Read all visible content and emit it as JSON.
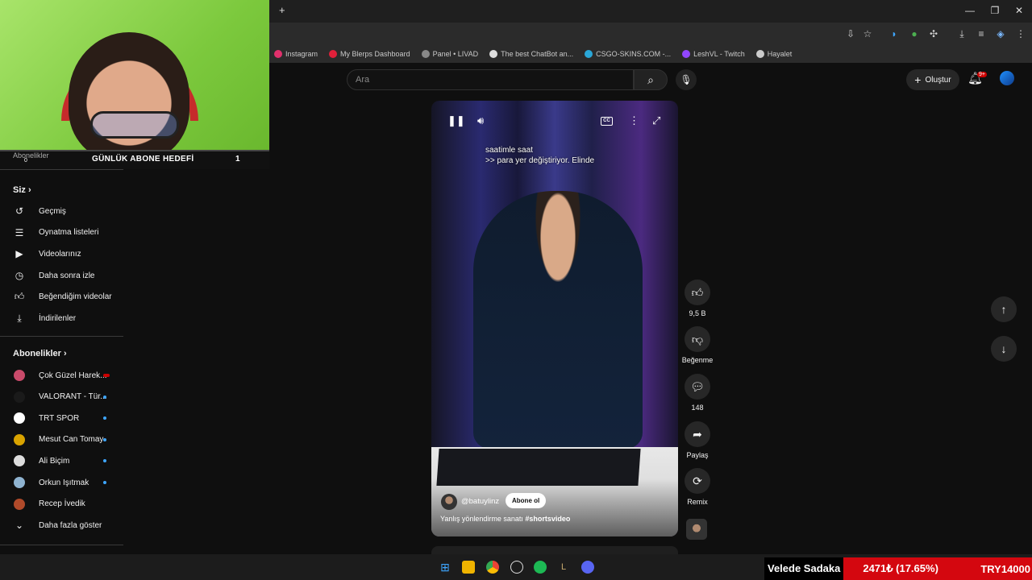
{
  "browser": {
    "new_tab": "+",
    "window_controls": {
      "minimize": "—",
      "maximize": "❐",
      "close": "✕"
    },
    "bookmarks": [
      {
        "label": "Instagram",
        "color": "#e1306c"
      },
      {
        "label": "My Blerps Dashboard",
        "color": "#e0203a"
      },
      {
        "label": "Panel • LIVAD",
        "color": "#888888"
      },
      {
        "label": "The best ChatBot an...",
        "color": "#dddddd"
      },
      {
        "label": "CSGO-SKINS.COM -...",
        "color": "#2aa7d8"
      },
      {
        "label": "LeshVL - Twitch",
        "color": "#9146ff"
      },
      {
        "label": "Hayalet",
        "color": "#cccccc"
      }
    ]
  },
  "overlay": {
    "sub_goal_label": "GÜNLÜK ABONE HEDEFİ",
    "sub_goal_count": "1",
    "sub_goal_zero": "0"
  },
  "sidebar": {
    "subscriptions_top": "Abonelikler",
    "you_header": "Siz",
    "you_items": [
      {
        "label": "Geçmiş",
        "icon": "history-icon"
      },
      {
        "label": "Oynatma listeleri",
        "icon": "playlist-icon"
      },
      {
        "label": "Videolarınız",
        "icon": "your-videos-icon"
      },
      {
        "label": "Daha sonra izle",
        "icon": "watch-later-icon"
      },
      {
        "label": "Beğendiğim videolar",
        "icon": "liked-icon"
      },
      {
        "label": "İndirilenler",
        "icon": "download-icon"
      }
    ],
    "subs_header": "Abonelikler",
    "subs": [
      {
        "label": "Çok Güzel Harek...",
        "color": "#c94a6a",
        "live": true
      },
      {
        "label": "VALORANT - Tür...",
        "color": "#1a1a1a",
        "live": false
      },
      {
        "label": "TRT SPOR",
        "color": "#ffffff",
        "live": false
      },
      {
        "label": "Mesut Can Tomay",
        "color": "#d9a300",
        "live": false
      },
      {
        "label": "Ali Biçim",
        "color": "#dddddd",
        "live": false
      },
      {
        "label": "Orkun Işıtmak",
        "color": "#8fb3d0",
        "live": false
      },
      {
        "label": "Recep İvedik",
        "color": "#b04a2a",
        "live": false
      }
    ],
    "show_more": "Daha fazla göster"
  },
  "header": {
    "search_placeholder": "Ara",
    "create_label": "Oluştur",
    "bell_badge": "9+"
  },
  "player": {
    "subtitle_line1": "saatimle saat",
    "subtitle_line2": ">> para yer değiştiriyor. Elinde",
    "cc_label": "CC",
    "channel": "@batuylinz",
    "subscribe": "Abone ol",
    "title_text": "Yanlış yönlendirme sanatı ",
    "title_hashtag": "#shortsvideo"
  },
  "actions": {
    "likes": "9,5 B",
    "dislike_label": "Beğenme",
    "comments": "148",
    "share_label": "Paylaş",
    "remix_label": "Remix"
  },
  "ticker": {
    "name": "Velede Sadaka",
    "amount": "2471₺ (17.65%)",
    "target": "TRY14000"
  }
}
